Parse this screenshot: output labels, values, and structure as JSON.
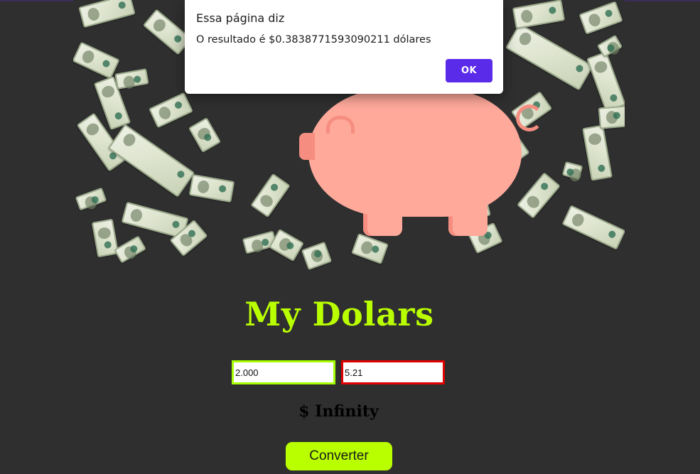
{
  "alert": {
    "title": "Essa página diz",
    "message": "O resultado é $0.3838771593090211 dólares",
    "ok_label": "OK"
  },
  "hero": {
    "image_desc": "piggy-bank-with-flying-dollar-bills"
  },
  "page": {
    "title": "My Dolars"
  },
  "inputs": {
    "amount_value": "2.000",
    "rate_value": "5.21"
  },
  "result": {
    "text": "$ Infinity"
  },
  "actions": {
    "convert_label": "Converter"
  },
  "colors": {
    "accent": "#b9ff00",
    "background": "#2f2f2f",
    "pig": "#ffa99b",
    "dialog_button": "#5b2bea",
    "input_a_border": "#a6ff00",
    "input_b_border": "#e00000"
  }
}
